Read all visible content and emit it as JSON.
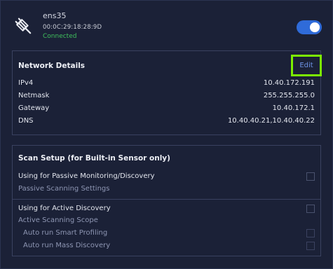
{
  "interface": {
    "name": "ens35",
    "mac": "00:0C:29:18:28:9D",
    "status": "Connected",
    "enabled": true,
    "icon": "ethernet-plug-icon"
  },
  "network_details": {
    "title": "Network Details",
    "edit_label": "Edit",
    "rows": [
      {
        "label": "IPv4",
        "value": "10.40.172.191"
      },
      {
        "label": "Netmask",
        "value": "255.255.255.0"
      },
      {
        "label": "Gateway",
        "value": "10.40.172.1"
      },
      {
        "label": "DNS",
        "value": "10.40.40.21,10.40.40.22"
      }
    ]
  },
  "scan_setup": {
    "title": "Scan Setup (for Built-in Sensor only)",
    "passive": {
      "label": "Using for Passive Monitoring/Discovery",
      "checked": false,
      "settings_label": "Passive Scanning Settings"
    },
    "active": {
      "label": "Using for Active Discovery",
      "checked": false,
      "scope_label": "Active Scanning Scope",
      "options": [
        {
          "label": "Auto run Smart Profiling",
          "checked": false
        },
        {
          "label": "Auto run Mass Discovery",
          "checked": false
        }
      ]
    }
  },
  "colors": {
    "background": "#1b2137",
    "accent": "#2f6bd9",
    "status_ok": "#3fbf5c",
    "highlight": "#7cf000"
  }
}
